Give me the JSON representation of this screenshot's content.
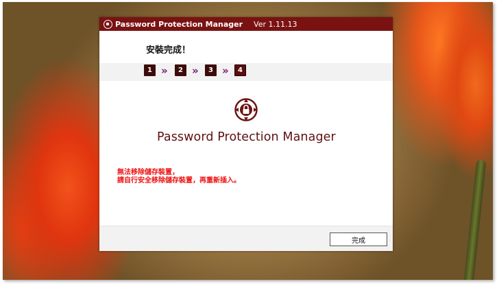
{
  "window": {
    "title": "Password Protection Manager",
    "version": "Ver 1.11.13"
  },
  "header": {
    "title": "安裝完成！"
  },
  "steps": {
    "items": [
      "1",
      "2",
      "3",
      "4"
    ],
    "separator": "»",
    "current": 4
  },
  "content": {
    "product_name": "Password Protection Manager",
    "message_line1": "無法移除儲存裝置，",
    "message_line2": "請自行安全移除儲存裝置，再重新插入。"
  },
  "footer": {
    "finish_label": "完成"
  },
  "colors": {
    "brand": "#7a1212",
    "step_bg": "#3d0b0b",
    "chevron": "#6b1a6b",
    "error_text": "#ee1111"
  },
  "icons": {
    "title_logo": "lock-compass-icon",
    "product_logo": "lock-compass-icon"
  }
}
